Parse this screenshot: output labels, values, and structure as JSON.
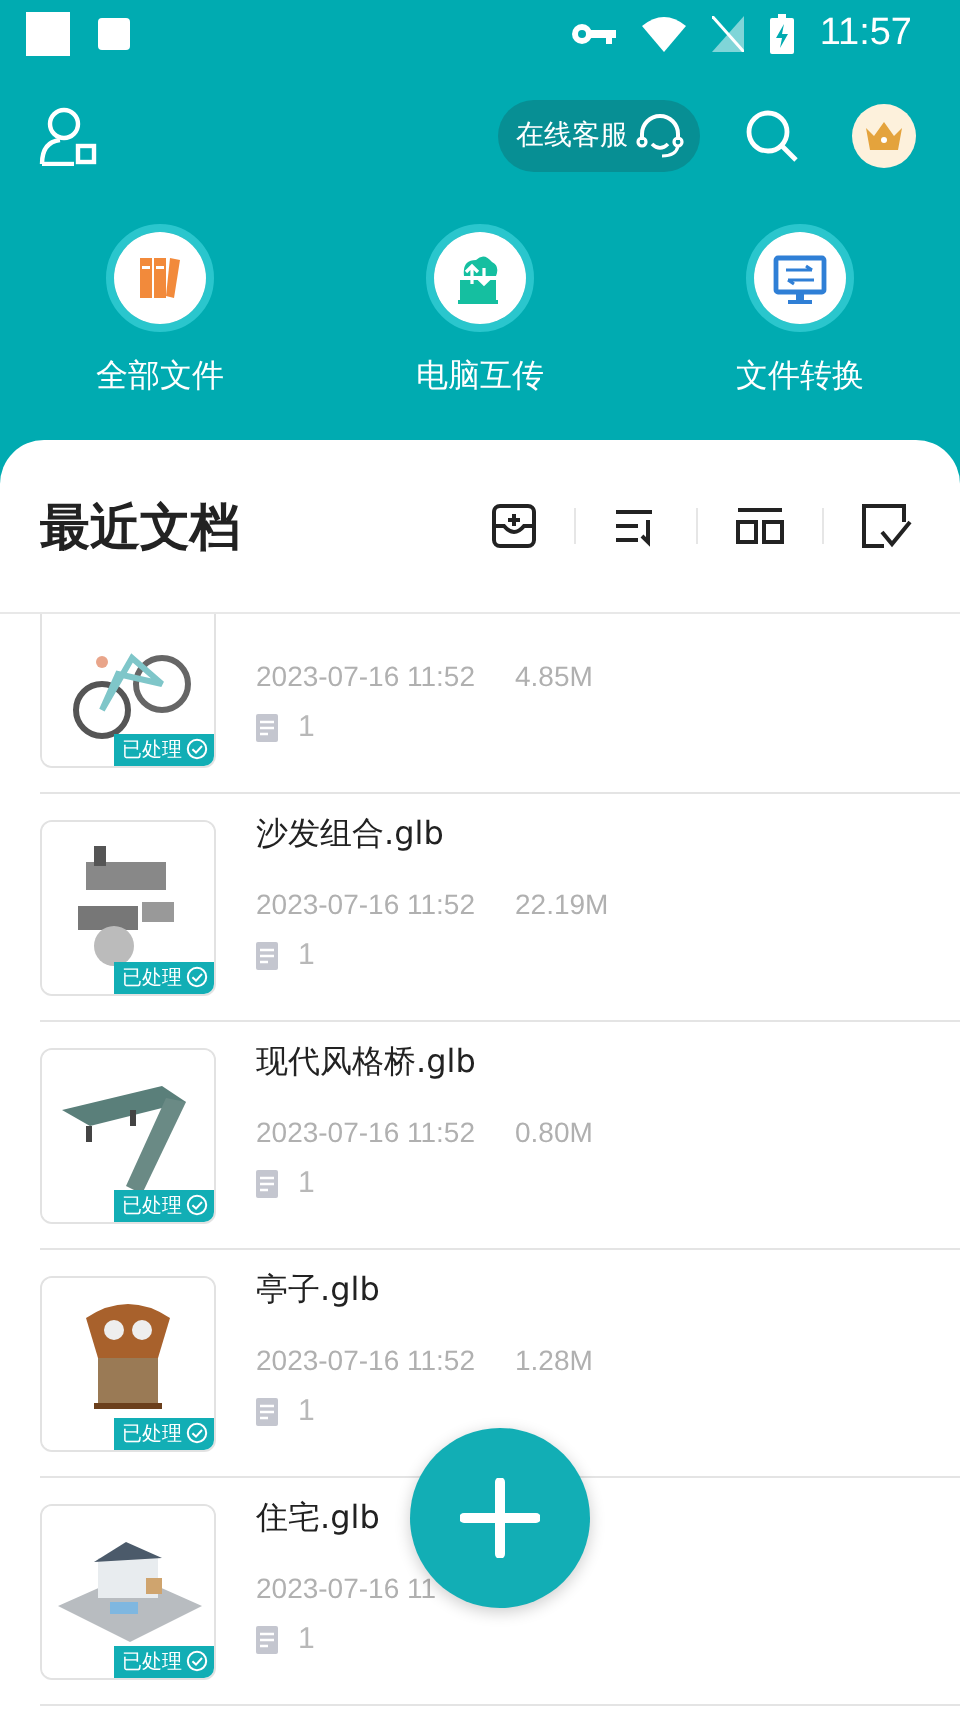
{
  "status_bar": {
    "time": "11:57"
  },
  "header": {
    "service_button": "在线客服"
  },
  "shortcuts": [
    {
      "label": "全部文件",
      "kind": "folders"
    },
    {
      "label": "电脑互传",
      "kind": "transfer"
    },
    {
      "label": "文件转换",
      "kind": "convert"
    }
  ],
  "recent": {
    "title": "最近文档",
    "files": [
      {
        "kind": "picture",
        "date": "2023-07-16 11:52",
        "size": "4.85M",
        "count": "1",
        "badge": "已处理"
      },
      {
        "kind": "picture",
        "name": "沙发组合.glb",
        "date": "2023-07-16 11:52",
        "size": "22.19M",
        "count": "1",
        "badge": "已处理"
      },
      {
        "kind": "picture",
        "name": "现代风格桥.glb",
        "date": "2023-07-16 11:52",
        "size": "0.80M",
        "count": "1",
        "badge": "已处理"
      },
      {
        "kind": "picture",
        "name": "亭子.glb",
        "date": "2023-07-16 11:52",
        "size": "1.28M",
        "count": "1",
        "badge": "已处理"
      },
      {
        "kind": "picture",
        "name": "住宅.glb",
        "date": "2023-07-16 11",
        "count": "1",
        "badge": "已处理"
      }
    ]
  }
}
